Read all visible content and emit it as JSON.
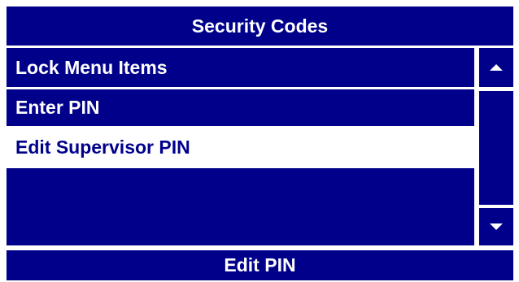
{
  "header": {
    "title": "Security Codes"
  },
  "menu": {
    "items": [
      {
        "label": "Lock Menu Items",
        "selected": false
      },
      {
        "label": "Enter PIN",
        "selected": false
      },
      {
        "label": "Edit Supervisor PIN",
        "selected": true
      },
      {
        "label": "",
        "selected": false
      }
    ]
  },
  "scrollbar": {
    "up_icon": "triangle-up-icon",
    "down_icon": "triangle-down-icon"
  },
  "footer": {
    "action_label": "Edit PIN"
  },
  "colors": {
    "primary": "#00008b",
    "background": "#ffffff",
    "selected_bg": "#ffffff",
    "selected_text": "#00008b",
    "text": "#ffffff"
  }
}
